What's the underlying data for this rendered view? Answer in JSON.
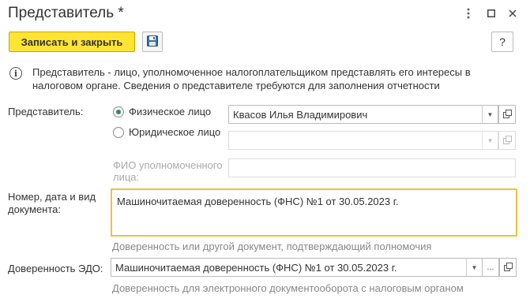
{
  "window": {
    "title": "Представитель *"
  },
  "toolbar": {
    "save_close_label": "Записать и закрыть",
    "help_label": "?"
  },
  "info": {
    "text": "Представитель - лицо, уполномоченное налогоплательщиком представлять его интересы в налоговом органе. Сведения о представителе требуются для заполнения отчетности"
  },
  "form": {
    "representative_label": "Представитель:",
    "radio_individual_label": "Физическое лицо",
    "radio_legal_label": "Юридическое лицо",
    "selected_type": "individual",
    "individual_value": "Квасов Илья Владимирович",
    "legal_value": "",
    "authorized_person_label": "ФИО уполномоченного лица:",
    "authorized_person_value": "",
    "document_label": "Номер, дата и вид документа:",
    "document_value": "Машиночитаемая доверенность (ФНС) №1 от 30.05.2023 г.",
    "document_hint": "Доверенность или другой документ, подтверждающий полномочия",
    "edo_label": "Доверенность ЭДО:",
    "edo_value": "Машиночитаемая доверенность (ФНС) №1 от 30.05.2023 г.",
    "edo_hint": "Доверенность для электронного документооборота с налоговым органом"
  },
  "colors": {
    "primary_button": "#ffe433",
    "focus_border": "#f0c040",
    "radio_selected": "#2e8b57",
    "hint_text": "#888888"
  }
}
